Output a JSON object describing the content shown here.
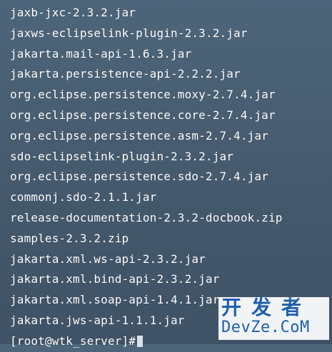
{
  "terminal": {
    "background_color": "#4a6176",
    "text_color": "#ffffff",
    "lines": [
      "jaxb-jxc-2.3.2.jar",
      "jaxws-eclipselink-plugin-2.3.2.jar",
      "jakarta.mail-api-1.6.3.jar",
      "jakarta.persistence-api-2.2.2.jar",
      "org.eclipse.persistence.moxy-2.7.4.jar",
      "org.eclipse.persistence.core-2.7.4.jar",
      "org.eclipse.persistence.asm-2.7.4.jar",
      "sdo-eclipselink-plugin-2.3.2.jar",
      "org.eclipse.persistence.sdo-2.7.4.jar",
      "commonj.sdo-2.1.1.jar",
      "release-documentation-2.3.2-docbook.zip",
      "samples-2.3.2.zip",
      "jakarta.xml.ws-api-2.3.2.jar",
      "jakarta.xml.bind-api-2.3.2.jar",
      "jakarta.xml.soap-api-1.4.1.jar",
      "jakarta.jws-api-1.1.1.jar"
    ],
    "prompt": "[root@wtk_server]#"
  },
  "watermark": {
    "top_text": "开发者",
    "bottom_text": "DevZe.CoM",
    "color": "#1e5fb0"
  }
}
